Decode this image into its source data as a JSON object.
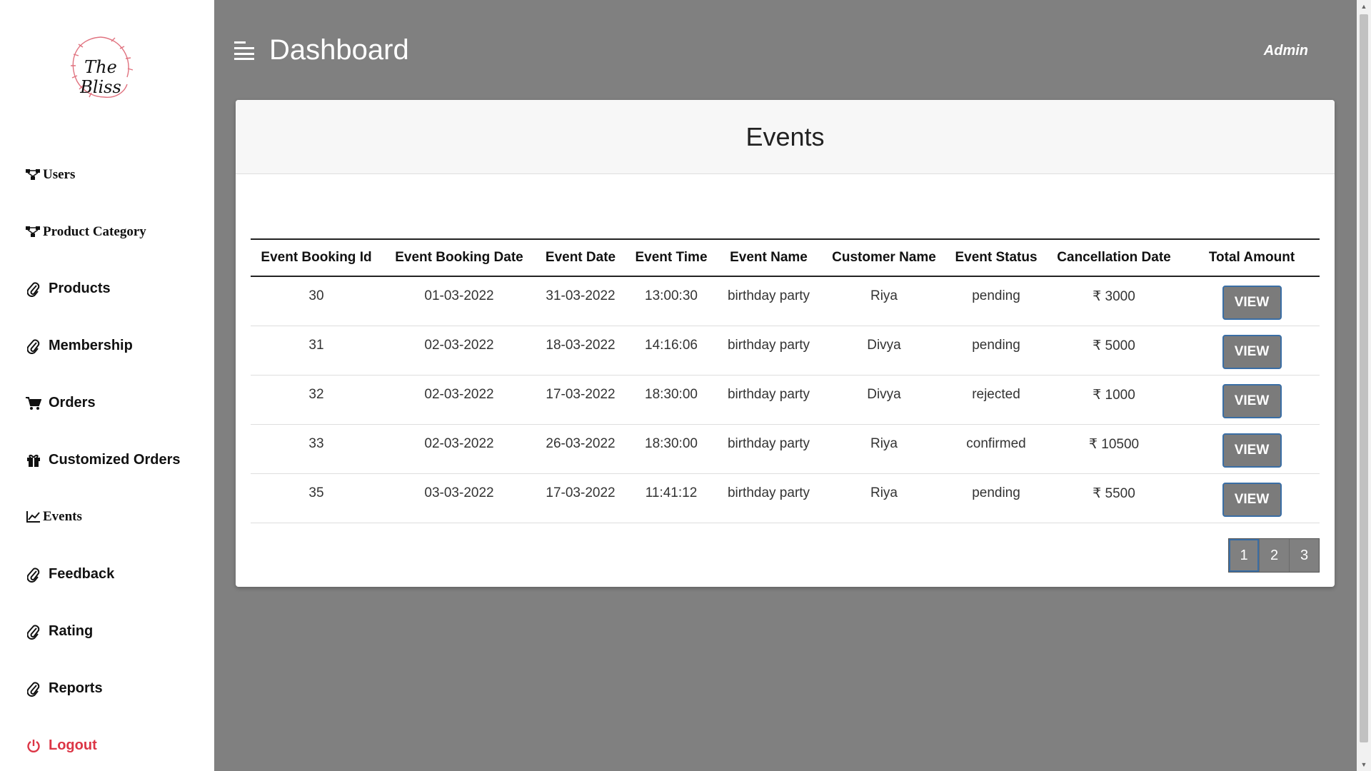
{
  "brand": {
    "logo_text": "The Bliss",
    "accent": "#e0727f"
  },
  "sidebar": {
    "items": [
      {
        "label": "Users",
        "icon": "sitemap-icon"
      },
      {
        "label": "Product Category",
        "icon": "sitemap-icon"
      },
      {
        "label": "Products",
        "icon": "paperclip-icon"
      },
      {
        "label": "Membership",
        "icon": "paperclip-icon"
      },
      {
        "label": "Orders",
        "icon": "cart-icon"
      },
      {
        "label": "Customized Orders",
        "icon": "gift-icon"
      },
      {
        "label": "Events",
        "icon": "line-chart-icon"
      },
      {
        "label": "Feedback",
        "icon": "paperclip-icon"
      },
      {
        "label": "Rating",
        "icon": "paperclip-icon"
      },
      {
        "label": "Reports",
        "icon": "paperclip-icon"
      },
      {
        "label": "Logout",
        "icon": "power-icon"
      }
    ]
  },
  "header": {
    "title": "Dashboard",
    "user": "Admin"
  },
  "card": {
    "title": "Events"
  },
  "table": {
    "columns": [
      "Event Booking Id",
      "Event Booking Date",
      "Event Date",
      "Event Time",
      "Event Name",
      "Customer Name",
      "Event Status",
      "Cancellation Date",
      "Total Amount"
    ],
    "rows": [
      {
        "id": "30",
        "booking_date": "01-03-2022",
        "event_date": "31-03-2022",
        "time": "13:00:30",
        "name": "birthday party",
        "customer": "Riya",
        "status": "pending",
        "amount": "₹ 3000",
        "action": "VIEW"
      },
      {
        "id": "31",
        "booking_date": "02-03-2022",
        "event_date": "18-03-2022",
        "time": "14:16:06",
        "name": "birthday party",
        "customer": "Divya",
        "status": "pending",
        "amount": "₹ 5000",
        "action": "VIEW"
      },
      {
        "id": "32",
        "booking_date": "02-03-2022",
        "event_date": "17-03-2022",
        "time": "18:30:00",
        "name": "birthday party",
        "customer": "Divya",
        "status": "rejected",
        "amount": "₹ 1000",
        "action": "VIEW"
      },
      {
        "id": "33",
        "booking_date": "02-03-2022",
        "event_date": "26-03-2022",
        "time": "18:30:00",
        "name": "birthday party",
        "customer": "Riya",
        "status": "confirmed",
        "amount": "₹ 10500",
        "action": "VIEW"
      },
      {
        "id": "35",
        "booking_date": "03-03-2022",
        "event_date": "17-03-2022",
        "time": "11:41:12",
        "name": "birthday party",
        "customer": "Riya",
        "status": "pending",
        "amount": "₹ 5500",
        "action": "VIEW"
      }
    ]
  },
  "pagination": {
    "pages": [
      "1",
      "2",
      "3"
    ],
    "current": "1"
  }
}
